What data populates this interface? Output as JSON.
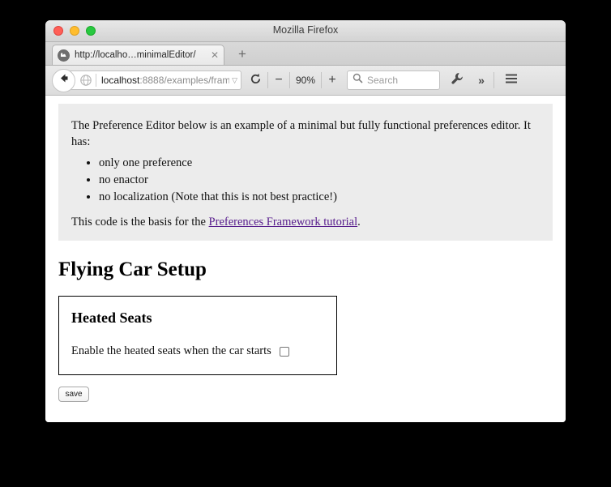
{
  "window": {
    "title": "Mozilla Firefox",
    "controls": {
      "close": "close-button",
      "minimize": "minimize-button",
      "maximize": "maximize-button"
    }
  },
  "tabs": {
    "active": {
      "title": "http://localho…minimalEditor/",
      "close_label": "✕",
      "favicon": "globe-icon"
    },
    "new_tab_label": "+"
  },
  "toolbar": {
    "back_label": "back-icon",
    "url_host": "localhost",
    "url_path": ":8888/examples/fram",
    "url_dropdown": "▽",
    "reload_label": "⟳",
    "zoom_out_label": "−",
    "zoom_level": "90%",
    "zoom_in_label": "+",
    "search_placeholder": "Search",
    "wrench_label": "wrench-icon",
    "overflow_label": "»",
    "menu_label": "hamburger-icon"
  },
  "page": {
    "intro": "The Preference Editor below is an example of a minimal but fully functional preferences editor. It has:",
    "features": [
      "only one preference",
      "no enactor",
      "no localization (Note that this is not best practice!)"
    ],
    "basis_prefix": "This code is the basis for the ",
    "link_text": "Preferences Framework tutorial",
    "basis_suffix": ".",
    "title": "Flying Car Setup",
    "panel": {
      "title": "Heated Seats",
      "pref_label": "Enable the heated seats when the car starts",
      "checked": false
    },
    "save_label": "save"
  },
  "colors": {
    "link": "#551a8b",
    "panel_background": "#ececec",
    "page_background": "#ffffff",
    "desktop_background": "#000000"
  }
}
